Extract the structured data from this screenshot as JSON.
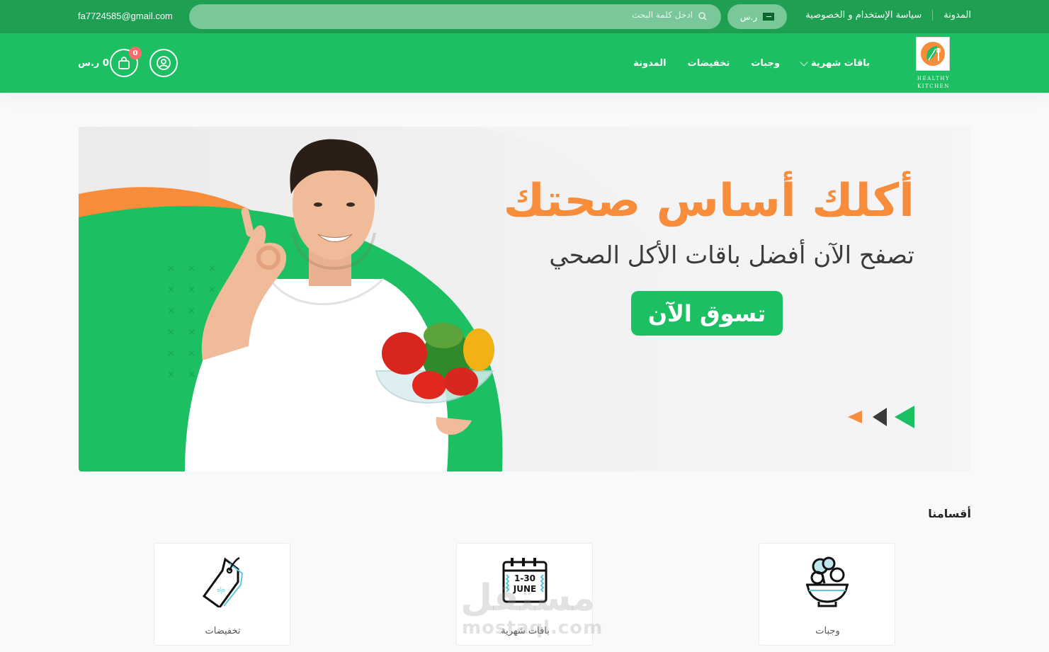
{
  "topbar": {
    "email": "fa7724585@gmail.com",
    "search_placeholder": "ادخل كلمة البحث",
    "currency": "ر.س",
    "links": [
      "المدونة",
      "سياسة الإستخدام و الخصوصية"
    ]
  },
  "nav": {
    "logo_line1": "HEALTHY",
    "logo_line2": "KITCHEN",
    "menu": [
      "باقات شهرية",
      "وجبات",
      "تخفيضات",
      "المدونة"
    ],
    "cart_count": "0",
    "cart_total": "0 ر.س"
  },
  "hero": {
    "title": "أكلك أساس صحتك",
    "subtitle": "تصفح الآن أفضل باقات الأكل الصحي",
    "cta": "تسوق الآن"
  },
  "categories": {
    "title": "أقسامنا",
    "items": [
      {
        "label": "وجبات",
        "icon": "salad-bowl-icon"
      },
      {
        "label": "باقات شهرية",
        "icon": "calendar-icon",
        "icon_text_1": "1-30",
        "icon_text_2": "JUNE"
      },
      {
        "label": "تخفيضات",
        "icon": "price-tag-icon"
      }
    ]
  },
  "watermark": {
    "line1": "مستقل",
    "line2": "mostaql.com"
  },
  "colors": {
    "brand_green": "#1cbf62",
    "dark_green": "#1e9f52",
    "orange": "#f78c3b"
  }
}
